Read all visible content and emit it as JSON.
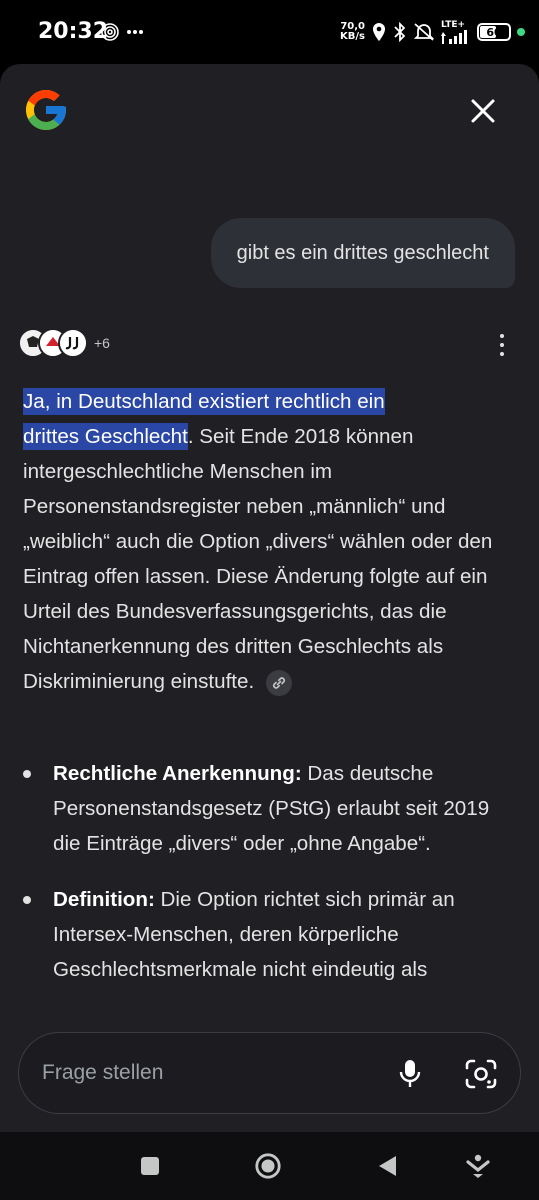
{
  "status_bar": {
    "time": "20:32",
    "net_speed_value": "70,0",
    "net_speed_unit": "KB/s",
    "network_type": "LTE+",
    "battery": "60",
    "battery_level": 0.6
  },
  "assistant": {
    "user_message": "gibt es ein drittes geschlecht",
    "sources_more_count": "+6",
    "answer_highlight_line1": "Ja, in Deutschland existiert rechtlich ein",
    "answer_highlight_line2": "drittes Geschlecht",
    "answer_body": ". Seit Ende 2018 können intergeschlechtliche Menschen im Personenstandsregister neben „männlich“ und „weiblich“ auch die Option „divers“ wählen oder den Eintrag offen lassen. Diese Änderung folgte auf ein Urteil des Bundesverfassungsgerichts, das die Nichtanerkennung des dritten Geschlechts als Diskriminierung einstufte.",
    "bullets": [
      {
        "title": "Rechtliche Anerkennung:",
        "text": " Das deutsche Personenstandsgesetz (PStG) erlaubt seit 2019 die Einträge „divers“ oder „ohne Angabe“."
      },
      {
        "title": "Definition:",
        "text": " Die Option richtet sich primär an Intersex-Menschen, deren körperliche Geschlechtsmerkmale nicht eindeutig als"
      }
    ],
    "input_placeholder": "Frage stellen"
  },
  "icons": {
    "logo": "google-g-logo",
    "close": "close-icon",
    "more": "more-vert-icon",
    "link": "link-icon",
    "mic": "mic-icon",
    "lens": "google-lens-icon"
  },
  "colors": {
    "sheet_bg": "#1f1f24",
    "highlight": "#2b47a5",
    "bubble_bg": "#2e3038"
  }
}
